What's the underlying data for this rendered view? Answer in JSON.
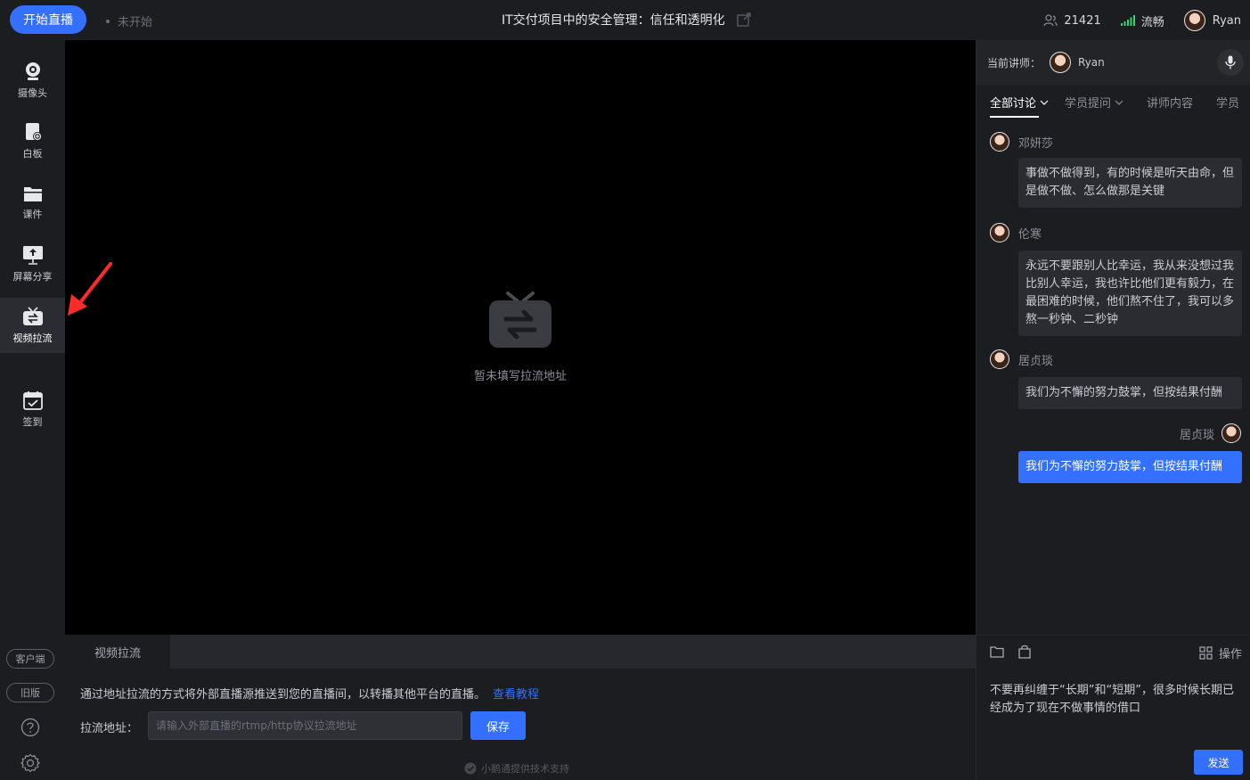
{
  "topbar": {
    "start_label": "开始直播",
    "status": "未开始",
    "title": "IT交付项目中的安全管理：信任和透明化",
    "viewers": "21421",
    "network": "流畅",
    "user": "Ryan"
  },
  "sidebar": {
    "items": [
      {
        "label": "摄像头",
        "icon": "camera-icon"
      },
      {
        "label": "白板",
        "icon": "whiteboard-icon"
      },
      {
        "label": "课件",
        "icon": "courseware-icon"
      },
      {
        "label": "屏幕分享",
        "icon": "screen-share-icon"
      },
      {
        "label": "视频拉流",
        "icon": "video-pull-icon"
      },
      {
        "label": "签到",
        "icon": "checkin-icon"
      }
    ],
    "client_label": "客户端",
    "old_label": "旧版"
  },
  "stage": {
    "placeholder": "暂未填写拉流地址"
  },
  "bottom": {
    "tab_label": "视频拉流",
    "description": "通过地址拉流的方式将外部直播源推送到您的直播间，以转播其他平台的直播。",
    "tutorial_link": "查看教程",
    "url_label": "拉流地址：",
    "url_placeholder": "请输入外部直播的rtmp/http协议拉流地址",
    "save_label": "保存",
    "powered_by": "小鹅通提供技术支持"
  },
  "right": {
    "lecturer_label": "当前讲师：",
    "lecturer_name": "Ryan",
    "tabs": [
      "全部讨论",
      "学员提问",
      "讲师内容",
      "学员"
    ],
    "messages": [
      {
        "name": "邓妍莎",
        "text": "事做不做得到，有的时候是听天由命，但是做不做、怎么做那是关键"
      },
      {
        "name": "伦寒",
        "text": "永远不要跟别人比幸运，我从来没想过我比别人幸运，我也许比他们更有毅力，在最困难的时候，他们熬不住了，我可以多熬一秒钟、二秒钟"
      },
      {
        "name": "居贞琰",
        "text": "我们为不懈的努力鼓掌，但按结果付酬"
      }
    ],
    "self_message": {
      "name": "居贞琰",
      "text": "我们为不懈的努力鼓掌，但按结果付酬"
    },
    "compose_text": "不要再纠缠于“长期”和“短期”，很多时候长期已经成为了现在不做事情的借口",
    "operate_label": "操作",
    "send_label": "发送"
  },
  "colors": {
    "accent": "#3370ff",
    "background": "#16171a",
    "panel": "#1c1d21",
    "annotation_arrow": "#ff2b2b",
    "signal": "#3bd16f"
  }
}
